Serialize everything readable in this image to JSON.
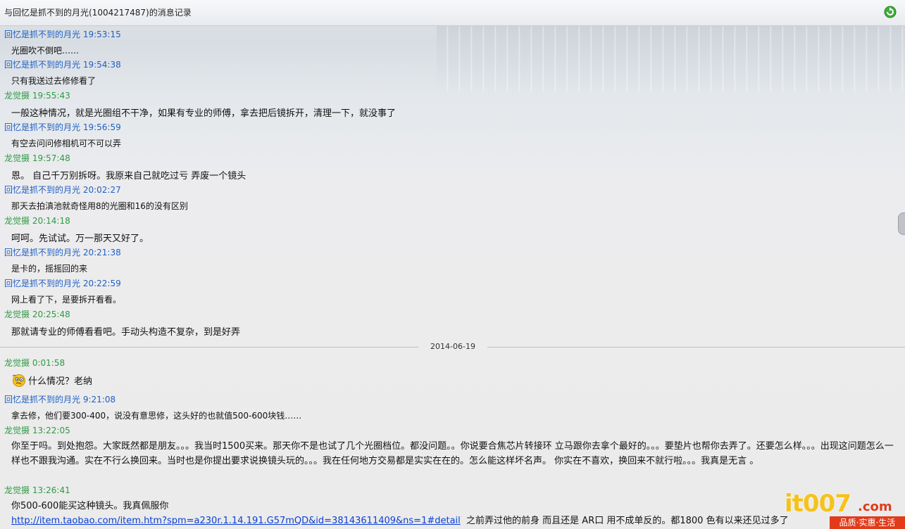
{
  "window": {
    "title": "与回忆是抓不到的月光(1004217487)的消息记录",
    "refresh_icon": "refresh-icon"
  },
  "colors": {
    "sender_a": "#1f5fc4",
    "sender_b": "#2d9a43",
    "link": "#0b3fd3"
  },
  "messages": [
    {
      "sender": "回忆是抓不到的月光",
      "time": "19:53:15",
      "text": "光圈吹不倒吧……"
    },
    {
      "sender": "回忆是抓不到的月光",
      "time": "19:54:38",
      "text": "只有我送过去修修看了"
    },
    {
      "sender": "龙觉摄",
      "time": "19:55:43",
      "text": "一般这种情况，就是光圈组不干净，如果有专业的师傅，拿去把后镜拆开，清理一下，就没事了"
    },
    {
      "sender": "回忆是抓不到的月光",
      "time": "19:56:59",
      "text": "有空去问问修相机可不可以弄"
    },
    {
      "sender": "龙觉摄",
      "time": "19:57:48",
      "text": "恩。 自己千万别拆呀。我原来自己就吃过亏 弄废一个镜头"
    },
    {
      "sender": "回忆是抓不到的月光",
      "time": "20:02:27",
      "text": "那天去拍滇池就奇怪用8的光圈和16的没有区别"
    },
    {
      "sender": "龙觉摄",
      "time": "20:14:18",
      "text": "呵呵。先试试。万一那天又好了。"
    },
    {
      "sender": "回忆是抓不到的月光",
      "time": "20:21:38",
      "text": "是卡的，摇摇回的来"
    },
    {
      "sender": "回忆是抓不到的月光",
      "time": "20:22:59",
      "text": "网上看了下，是要拆开看看。"
    },
    {
      "sender": "龙觉摄",
      "time": "20:25:48",
      "text": "那就请专业的师傅看看吧。手动头构造不复杂，到是好弄"
    }
  ],
  "date_divider": "2014-06-19",
  "messages2": [
    {
      "sender": "龙觉摄",
      "time": "0:01:58",
      "text": "什么情况？老纳",
      "emoji": "confused-face-icon"
    },
    {
      "sender": "回忆是抓不到的月光",
      "time": "9:21:08",
      "text": "拿去修，他们要300-400，说没有意思修，这头好的也就值500-600块钱……"
    },
    {
      "sender": "龙觉摄",
      "time": "13:22:05",
      "text": "你至于吗。到处抱怨。大家既然都是朋友。。。我当时1500买来。那天你不是也试了几个光圈档位。都没问题。。你说要合焦芯片转接环 立马跟你去拿个最好的。。。要垫片也帮你去弄了。还要怎么样。。。出现这问题怎么一样也不跟我沟通。实在不行么换回来。当时也是你提出要求说换镜头玩的。。。我在任何地方交易都是实实在在的。怎么能这样坏名声。 你实在不喜欢，换回来不就行啦。。。我真是无言 。"
    },
    {
      "sender": "龙觉摄",
      "time": "13:26:41",
      "text": "你500-600能买这种镜头。我真佩服你",
      "link": "http://item.taobao.com/item.htm?spm=a230r.1.14.191.G57mQD&id=38143611409&ns=1#detail",
      "after_link": "之前弄过他的前身 而且还是 AR口 用不成单反的。都1800 色有以来还见过多了"
    }
  ],
  "watermark": {
    "logo": "it007",
    "domain": ".com",
    "slogan": "品质·实惠·生活"
  }
}
